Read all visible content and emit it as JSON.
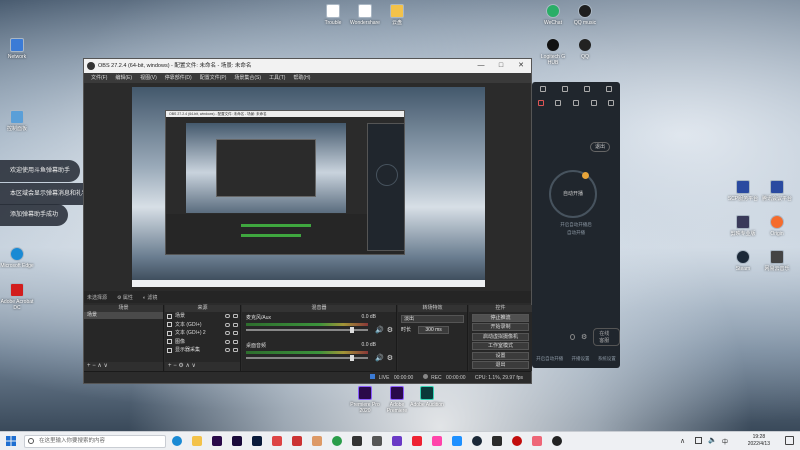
{
  "desktop": {
    "icons_left": [
      {
        "label": "Network"
      },
      {
        "label": "控制面板"
      },
      {
        "label": "Microsoft Edge"
      },
      {
        "label": "Adobe Acrobat DC"
      }
    ],
    "icons_top": [
      {
        "label": "Trouble"
      },
      {
        "label": "Wondershare"
      },
      {
        "label": "云盘"
      },
      {
        "label": "WeChat"
      },
      {
        "label": "QQ music"
      },
      {
        "label": "Logitech G HUB"
      },
      {
        "label": "QQ"
      }
    ],
    "icons_right": [
      {
        "label": "SCP服务平台"
      },
      {
        "label": "腾讯会议平台"
      },
      {
        "label": "剪映专业版"
      },
      {
        "label": "Origin"
      },
      {
        "label": "Steam"
      },
      {
        "label": "网易云音乐"
      }
    ],
    "icons_bottom": [
      {
        "label": "Premiere Pro 2020"
      },
      {
        "label": "Adobe Premiere"
      },
      {
        "label": "Adobe Audition"
      }
    ]
  },
  "notifications": [
    {
      "text": "欢迎使用斗鱼弹幕助手"
    },
    {
      "text": "本区域会显示弹幕消息和礼物消息"
    },
    {
      "text": "添加弹幕助手成功"
    }
  ],
  "obs": {
    "title": "OBS 27.2.4 (64-bit, windows) - 配置文件: 未命名 - 场景: 未命名",
    "window_controls": [
      "—",
      "□",
      "✕"
    ],
    "menu": [
      "文件(F)",
      "编辑(E)",
      "视图(V)",
      "停靠部件(D)",
      "配置文件(P)",
      "场景集合(S)",
      "工具(T)",
      "帮助(H)"
    ],
    "scene_bar": {
      "label": "未选择源",
      "properties": "属性",
      "filters": "滤镜"
    },
    "docks": {
      "scenes": {
        "header": "场景",
        "items": [
          "场景"
        ]
      },
      "sources": {
        "header": "来源",
        "items": [
          "场景",
          "文本 (GDI+)",
          "文本 (GDI+) 2",
          "图像",
          "显示器采集"
        ]
      },
      "mixer": {
        "header": "混音器",
        "tracks": [
          {
            "name": "麦克风/Aux",
            "db": "0.0 dB"
          },
          {
            "name": "桌面音频",
            "db": "0.0 dB"
          }
        ]
      },
      "transitions": {
        "header": "转场特效",
        "type": "淡出",
        "duration_label": "时长",
        "duration": "300 ms"
      },
      "controls": {
        "header": "控件",
        "buttons": [
          "停止推流",
          "开始录制",
          "启动虚拟摄像机",
          "工作室模式",
          "设置",
          "退出"
        ]
      }
    },
    "status": {
      "live_label": "LIVE",
      "live_time": "00:00:00",
      "rec_label": "REC",
      "rec_time": "00:00:00",
      "cpu": "CPU: 1.1%, 29.97 fps"
    },
    "preview_nested_label": "OBS 27.2.4 (64-bit, windows) - 配置文件: 未命名 - 场景: 未命名"
  },
  "side_panel": {
    "out_button": "退出",
    "circle_label": "自动开播",
    "hint1": "开启自动开播后",
    "hint2": "自动开播",
    "bottom": [
      "开启自动开播",
      "开播设置",
      "系统设置"
    ],
    "action": "在线客服"
  },
  "taskbar": {
    "search_placeholder": "在这里输入你要搜索的内容",
    "time": "19:28",
    "date": "2022/4/13",
    "lang": "中"
  },
  "colors": {
    "obs_bg": "#2b2b2b",
    "accent_green": "#3fa63f",
    "panel_bg": "#20262d",
    "badge_orange": "#e7a53a"
  }
}
